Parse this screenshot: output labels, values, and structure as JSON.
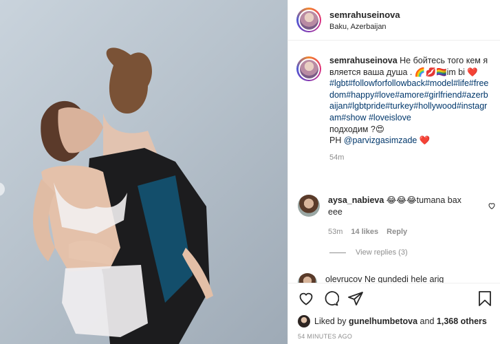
{
  "header": {
    "username": "semrahuseinova",
    "location": "Baku, Azerbaijan"
  },
  "caption": {
    "username": "semrahuseinova",
    "text": "Не бойтесь того кем является ваша душа . 🌈💋🏳️‍🌈im bi ❤️",
    "hashtags": "#lgbt#followforfollowback#model#life#freedom#happy#love#amore#girlfriend#azerbaijan#lgbtpride#turkey#hollywood#instagram#show #loveislove",
    "text2": "подходим ?😍",
    "credit_prefix": "PH",
    "mention": "@parvizgasimzade",
    "credit_suffix": "❤️",
    "time": "54m"
  },
  "comment": {
    "username": "aysa_nabieva",
    "text": "😂😂😂tumana bax eee",
    "time": "53m",
    "likes": "14 likes",
    "reply": "Reply"
  },
  "view_replies": "View replies (3)",
  "cut_comment": {
    "text": "olevrucov Ne gundedi hele arig"
  },
  "actions": {
    "like_icon": "heart-icon",
    "comment_icon": "comment-icon",
    "share_icon": "share-icon",
    "save_icon": "bookmark-icon"
  },
  "likes": {
    "prefix": "Liked by",
    "user": "gunelhumbetova",
    "middle": "and",
    "count": "1,368 others"
  },
  "post_time": "54 MINUTES AGO"
}
